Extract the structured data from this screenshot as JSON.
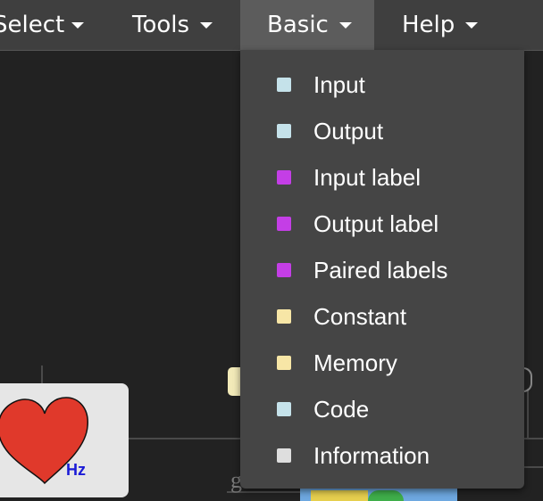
{
  "menubar": {
    "select": "Select",
    "tools": "Tools",
    "basic": "Basic",
    "help": "Help"
  },
  "basic_menu": {
    "items": [
      {
        "label": "Input",
        "color": "#c5e2ea"
      },
      {
        "label": "Output",
        "color": "#c5e2ea"
      },
      {
        "label": "Input label",
        "color": "#c43ee6"
      },
      {
        "label": "Output label",
        "color": "#c43ee6"
      },
      {
        "label": "Paired labels",
        "color": "#c43ee6"
      },
      {
        "label": "Constant",
        "color": "#f7e6a6"
      },
      {
        "label": "Memory",
        "color": "#f7e6a6"
      },
      {
        "label": "Code",
        "color": "#c5e2ea"
      },
      {
        "label": "Information",
        "color": "#dedede"
      }
    ]
  },
  "canvas": {
    "tile_label": "Hz",
    "tile_icon": "heart-icon",
    "heart_color": "#e0392b",
    "partial_char": "g"
  }
}
